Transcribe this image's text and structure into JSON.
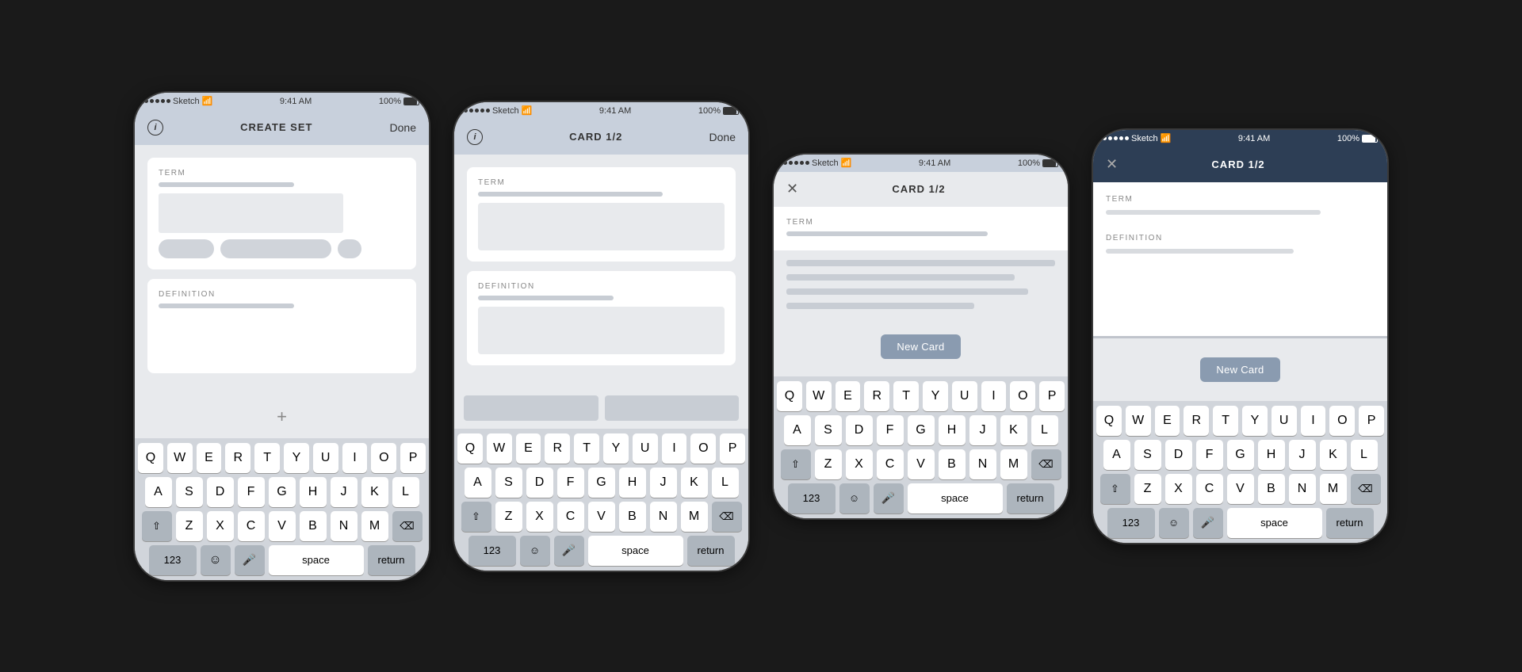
{
  "screens": [
    {
      "id": "screen1",
      "status": {
        "signal": "●●●●●",
        "brand": "Sketch",
        "wifi": "WiFi",
        "time": "9:41 AM",
        "battery": "100%",
        "theme": "light"
      },
      "nav": {
        "title": "CREATE SET",
        "left": "info",
        "right": "Done",
        "theme": "light"
      },
      "fields": [
        {
          "label": "TERM",
          "barWidth": "55%"
        },
        {
          "label": "DEFINITION",
          "barWidth": "75%"
        }
      ],
      "addButton": "+",
      "keyboard": true
    },
    {
      "id": "screen2",
      "status": {
        "signal": "●●●●●",
        "brand": "Sketch",
        "wifi": "WiFi",
        "time": "9:41 AM",
        "battery": "100%",
        "theme": "light"
      },
      "nav": {
        "title": "CARD 1/2",
        "left": "info",
        "right": "Done",
        "theme": "light"
      },
      "fields": [
        {
          "label": "TERM",
          "barWidth": "75%"
        },
        {
          "label": "DEFINITION",
          "barWidth": "60%"
        }
      ],
      "toolbar": true,
      "keyboard": true
    },
    {
      "id": "screen3",
      "status": {
        "signal": "●●●●●",
        "brand": "Sketch",
        "wifi": "WiFi",
        "time": "9:41 AM",
        "battery": "100%",
        "theme": "light"
      },
      "nav": {
        "title": "CARD 1/2",
        "left": "close",
        "right": "",
        "theme": "light"
      },
      "termLabel": "TERM",
      "termBar": "75%",
      "listLines": 4,
      "newCardLabel": "New Card",
      "keyboard": true
    },
    {
      "id": "screen4",
      "status": {
        "signal": "●●●●●",
        "brand": "Sketch",
        "wifi": "WiFi",
        "time": "9:41 AM",
        "battery": "100%",
        "theme": "dark"
      },
      "nav": {
        "title": "CARD 1/2",
        "left": "close",
        "right": "",
        "theme": "dark"
      },
      "termLabel": "TERM",
      "definitionLabel": "DEFINITION",
      "newCardLabel": "New Card",
      "keyboard": true
    }
  ],
  "keyboard": {
    "row1": [
      "Q",
      "W",
      "E",
      "R",
      "T",
      "Y",
      "U",
      "I",
      "O",
      "P"
    ],
    "row2": [
      "A",
      "S",
      "D",
      "F",
      "G",
      "H",
      "J",
      "K",
      "L"
    ],
    "row3": [
      "Z",
      "X",
      "C",
      "V",
      "B",
      "N",
      "M"
    ],
    "bottom": {
      "nums": "123",
      "emoji": "☺",
      "mic": "🎤",
      "space": "space",
      "return": "return",
      "delete": "⌫",
      "shift": "⇧"
    }
  }
}
